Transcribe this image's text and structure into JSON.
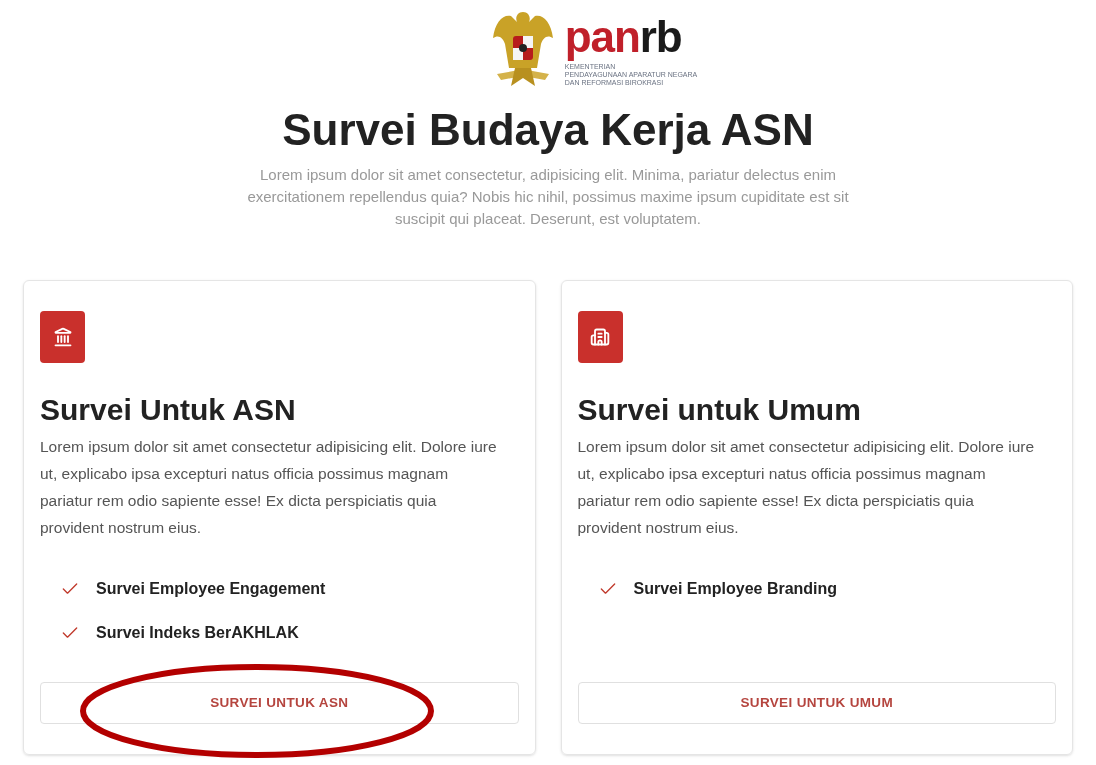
{
  "logo": {
    "wordmark_primary": "pan",
    "wordmark_secondary": "rb",
    "tagline": [
      "KEMENTERIAN",
      "PENDAYAGUNAAN APARATUR NEGARA",
      "DAN REFORMASI BIROKRASI"
    ]
  },
  "title": "Survei Budaya Kerja ASN",
  "intro": "Lorem ipsum dolor sit amet consectetur, adipisicing elit. Minima, pariatur delectus enim exercitationem repellendus quia? Nobis hic nihil, possimus maxime ipsum cupiditate est sit suscipit qui placeat. Deserunt, est voluptatem.",
  "cards": [
    {
      "kind": "landmark",
      "heading": "Survei Untuk ASN",
      "body": "Lorem ipsum dolor sit amet consectetur adipisicing elit. Dolore iure ut, explicabo ipsa excepturi natus officia possimus magnam pariatur rem odio sapiente esse! Ex dicta perspiciatis quia provident nostrum eius.",
      "features": [
        "Survei Employee Engagement",
        "Survei Indeks BerAKHLAK"
      ],
      "button": "SURVEI UNTUK ASN",
      "highlighted": true
    },
    {
      "kind": "building",
      "heading": "Survei untuk Umum",
      "body": "Lorem ipsum dolor sit amet consectetur adipisicing elit. Dolore iure ut, explicabo ipsa excepturi natus officia possimus magnam pariatur rem odio sapiente esse! Ex dicta perspiciatis quia provident nostrum eius.",
      "features": [
        "Survei Employee Branding"
      ],
      "button": "SURVEI UNTUK UMUM",
      "highlighted": false
    }
  ]
}
